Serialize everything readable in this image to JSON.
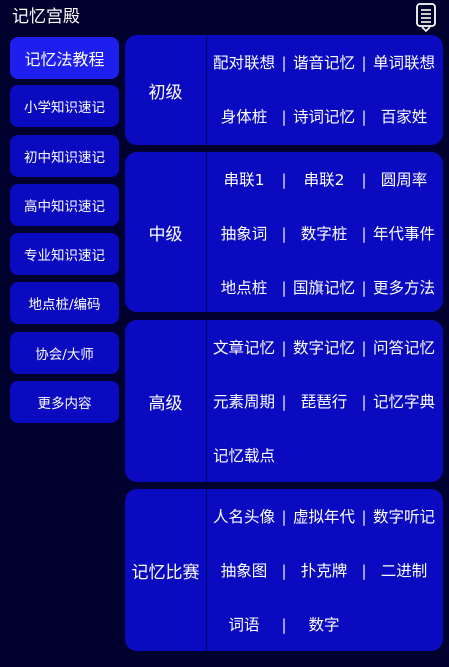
{
  "app": {
    "title": "记忆宫殿",
    "menu_icon": "document-list-icon"
  },
  "colors": {
    "background": "#01012e",
    "card": "#0a0ac0",
    "active": "#1e1eee",
    "text": "#ffffff"
  },
  "sidebar": {
    "items": [
      {
        "label": "记忆法教程",
        "active": true
      },
      {
        "label": "小学知识速记",
        "active": false
      },
      {
        "label": "初中知识速记",
        "active": false
      },
      {
        "label": "高中知识速记",
        "active": false
      },
      {
        "label": "专业知识速记",
        "active": false
      },
      {
        "label": "地点桩/编码",
        "active": false
      },
      {
        "label": "协会/大师",
        "active": false
      },
      {
        "label": "更多内容",
        "active": false
      }
    ]
  },
  "sections": [
    {
      "label": "初级",
      "rows": [
        [
          "配对联想",
          "谐音记忆",
          "单词联想"
        ],
        [
          "身体桩",
          "诗词记忆",
          "百家姓"
        ]
      ]
    },
    {
      "label": "中级",
      "rows": [
        [
          "串联1",
          "串联2",
          "圆周率"
        ],
        [
          "抽象词",
          "数字桩",
          "年代事件"
        ],
        [
          "地点桩",
          "国旗记忆",
          "更多方法"
        ]
      ]
    },
    {
      "label": "高级",
      "rows": [
        [
          "文章记忆",
          "数字记忆",
          "问答记忆"
        ],
        [
          "元素周期",
          "琵琶行",
          "记忆字典"
        ],
        [
          "记忆载点"
        ]
      ]
    },
    {
      "label": "记忆比赛",
      "rows": [
        [
          "人名头像",
          "虚拟年代",
          "数字听记"
        ],
        [
          "抽象图",
          "扑克牌",
          "二进制"
        ],
        [
          "词语",
          "数字"
        ]
      ]
    }
  ]
}
